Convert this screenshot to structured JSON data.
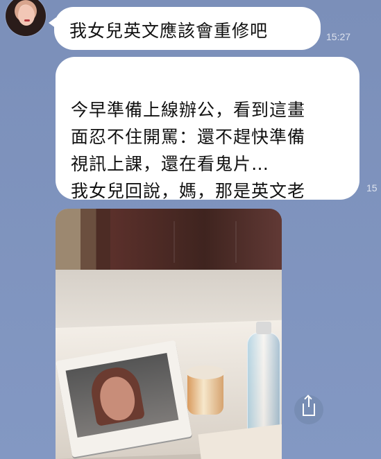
{
  "messages": [
    {
      "text": "我女兒英文應該會重修吧",
      "time": "15:27"
    },
    {
      "text": "今早準備上線辦公，看到這畫\n面忍不住開罵：還不趕快準備\n視訊上課，還在看鬼片…\n我女兒回說，媽，那是英文老\n師…",
      "time": "15"
    }
  ],
  "photo": {
    "alt": ""
  },
  "icons": {
    "avatar": "profile-avatar",
    "share": "share-icon"
  }
}
